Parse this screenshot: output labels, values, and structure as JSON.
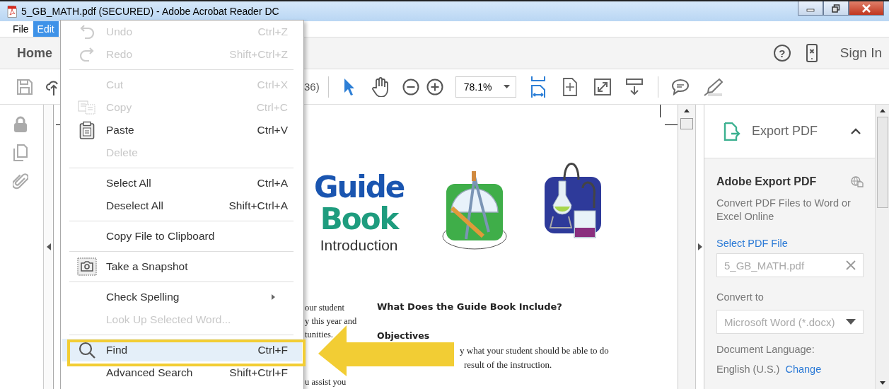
{
  "window": {
    "title": "5_GB_MATH.pdf (SECURED) - Adobe Acrobat Reader DC"
  },
  "menu_bar": [
    {
      "label": "File",
      "selected": false
    },
    {
      "label": "Edit",
      "selected": true
    }
  ],
  "nav": {
    "home": "Home",
    "help": "?",
    "sign_in": "Sign In"
  },
  "toolbar": {
    "page_count": "36)",
    "zoom": "78.1%"
  },
  "edit_menu": {
    "groups": [
      [
        {
          "label": "Undo",
          "shortcut": "Ctrl+Z",
          "disabled": true,
          "selected": false,
          "submenu": false
        },
        {
          "label": "Redo",
          "shortcut": "Shift+Ctrl+Z",
          "disabled": true,
          "selected": false,
          "submenu": false
        }
      ],
      [
        {
          "label": "Cut",
          "shortcut": "Ctrl+X",
          "disabled": true,
          "selected": false,
          "submenu": false
        },
        {
          "label": "Copy",
          "shortcut": "Ctrl+C",
          "disabled": true,
          "selected": false,
          "submenu": false
        },
        {
          "label": "Paste",
          "shortcut": "Ctrl+V",
          "disabled": false,
          "selected": false,
          "submenu": false
        },
        {
          "label": "Delete",
          "disabled": true,
          "selected": false,
          "submenu": false
        }
      ],
      [
        {
          "label": "Select All",
          "shortcut": "Ctrl+A",
          "disabled": false,
          "selected": false,
          "submenu": false
        },
        {
          "label": "Deselect All",
          "shortcut": "Shift+Ctrl+A",
          "disabled": false,
          "selected": false,
          "submenu": false
        }
      ],
      [
        {
          "label": "Copy File to Clipboard",
          "disabled": false,
          "selected": false,
          "submenu": false
        }
      ],
      [
        {
          "label": "Take a Snapshot",
          "disabled": false,
          "selected": false,
          "submenu": false
        }
      ],
      [
        {
          "label": "Check Spelling",
          "disabled": false,
          "selected": false,
          "submenu": true
        },
        {
          "label": "Look Up Selected Word...",
          "disabled": true,
          "selected": false,
          "submenu": false
        }
      ],
      [
        {
          "label": "Find",
          "shortcut": "Ctrl+F",
          "disabled": false,
          "selected": true,
          "submenu": false
        },
        {
          "label": "Advanced Search",
          "shortcut": "Shift+Ctrl+F",
          "disabled": false,
          "selected": false,
          "submenu": false
        }
      ]
    ]
  },
  "document": {
    "logo_line_1": "Guide",
    "logo_line_2": "Book",
    "logo_subtitle": "Introduction",
    "heading": "What Does the Guide Book Include?",
    "subheading": "Objectives",
    "left_lines": [
      "our student",
      "y this year and",
      "tunities.",
      "u assist you"
    ],
    "right_lines": [
      "y what your student should be able to do",
      "result of the instruction."
    ]
  },
  "export_panel": {
    "title": "Export PDF",
    "expanded": true,
    "heading": "Adobe Export PDF",
    "description": "Convert PDF Files to Word or Excel Online",
    "select_link": "Select PDF File",
    "file_value": "5_GB_MATH.pdf",
    "convert_label": "Convert to",
    "format_value": "Microsoft Word (*.docx)",
    "language_label": "Document Language:",
    "language_value": "English (U.S.)",
    "change_link": "Change"
  }
}
